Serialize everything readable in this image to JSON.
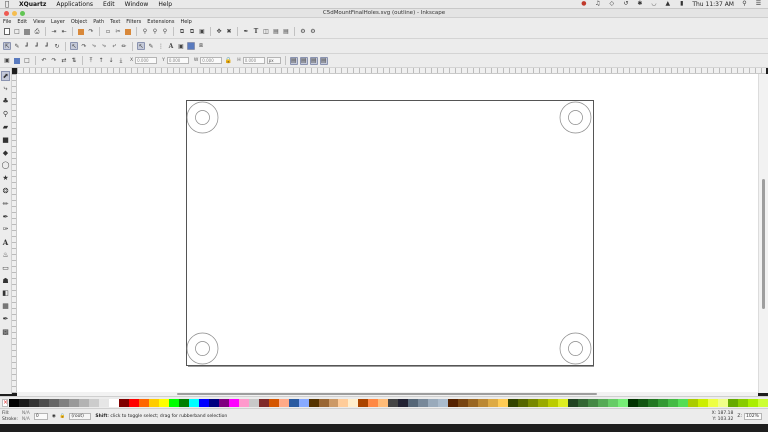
{
  "os_menubar": {
    "items": [
      "XQuartz",
      "Applications",
      "Edit",
      "Window",
      "Help"
    ],
    "clock": "Thu 11:37 AM"
  },
  "window": {
    "title": "C5dMountFinalHoles.svg (outline) - Inkscape",
    "lights": [
      "#ee5a52",
      "#f5bd4f",
      "#61c554"
    ]
  },
  "app_menu": [
    "File",
    "Edit",
    "View",
    "Layer",
    "Object",
    "Path",
    "Text",
    "Filters",
    "Extensions",
    "Help"
  ],
  "controls": {
    "x_label": "X",
    "x_value": "0.000",
    "y_label": "Y",
    "y_value": "0.000",
    "w_label": "W",
    "w_value": "0.000",
    "h_label": "H",
    "h_value": "0.000",
    "unit": "px"
  },
  "tool_icons": [
    "select-arrow-icon",
    "node-tool-icon",
    "tweak-tool-icon",
    "zoom-tool-icon",
    "measure-tool-icon",
    "rectangle-tool-icon",
    "3d-box-tool-icon",
    "ellipse-tool-icon",
    "star-tool-icon",
    "spiral-tool-icon",
    "pencil-tool-icon",
    "pen-tool-icon",
    "calligraphy-tool-icon",
    "text-tool-icon",
    "spray-tool-icon",
    "eraser-tool-icon",
    "bucket-tool-icon",
    "gradient-tool-icon",
    "mesh-tool-icon",
    "dropper-tool-icon",
    "connector-tool-icon"
  ],
  "palette_colors": [
    "#000000",
    "#1a1a1a",
    "#333333",
    "#4d4d4d",
    "#666666",
    "#808080",
    "#999999",
    "#b3b3b3",
    "#cccccc",
    "#e6e6e6",
    "#ffffff",
    "#800000",
    "#ff0000",
    "#ff6600",
    "#ffcc00",
    "#ffff00",
    "#00ff00",
    "#008000",
    "#00ffff",
    "#0000ff",
    "#000080",
    "#800080",
    "#ff00ff",
    "#ff99cc",
    "#c8c8c8",
    "#7f2a2a",
    "#d45500",
    "#ffaa88",
    "#2a5aa0",
    "#88aaff",
    "#553300",
    "#996633",
    "#cc9966",
    "#ffcc99",
    "#ffeecc",
    "#aa4400",
    "#ff8844",
    "#ffbb77",
    "#444444",
    "#222233",
    "#556677",
    "#778899",
    "#99aabb",
    "#aabbcc",
    "#552200",
    "#774411",
    "#996622",
    "#bb8833",
    "#ddaa44",
    "#ffcc55",
    "#334400",
    "#556600",
    "#778800",
    "#99aa00",
    "#bbcc00",
    "#ddee22",
    "#224422",
    "#336633",
    "#448844",
    "#55aa55",
    "#66cc66",
    "#77ee77",
    "#003300",
    "#115511",
    "#227722",
    "#339933",
    "#44bb44",
    "#55dd55",
    "#aacc00",
    "#ccee00",
    "#eeff44",
    "#f0ff88",
    "#66aa00",
    "#88cc00",
    "#aaee00",
    "#ccff33"
  ],
  "status": {
    "fill_label": "Fill:",
    "fill_value": "N/A",
    "stroke_label": "Stroke:",
    "stroke_value": "N/A",
    "opacity": "0",
    "layer": "(root)",
    "message_key": "Shift",
    "message_rest": ": click to toggle select; drag for rubberband selection",
    "coord_x": "X: 187.18",
    "coord_y": "Y: 103.32",
    "zoom_label": "Z:",
    "zoom_value": "102%"
  },
  "drawing": {
    "page_border": "#555555",
    "hole_stroke": "#888888"
  }
}
